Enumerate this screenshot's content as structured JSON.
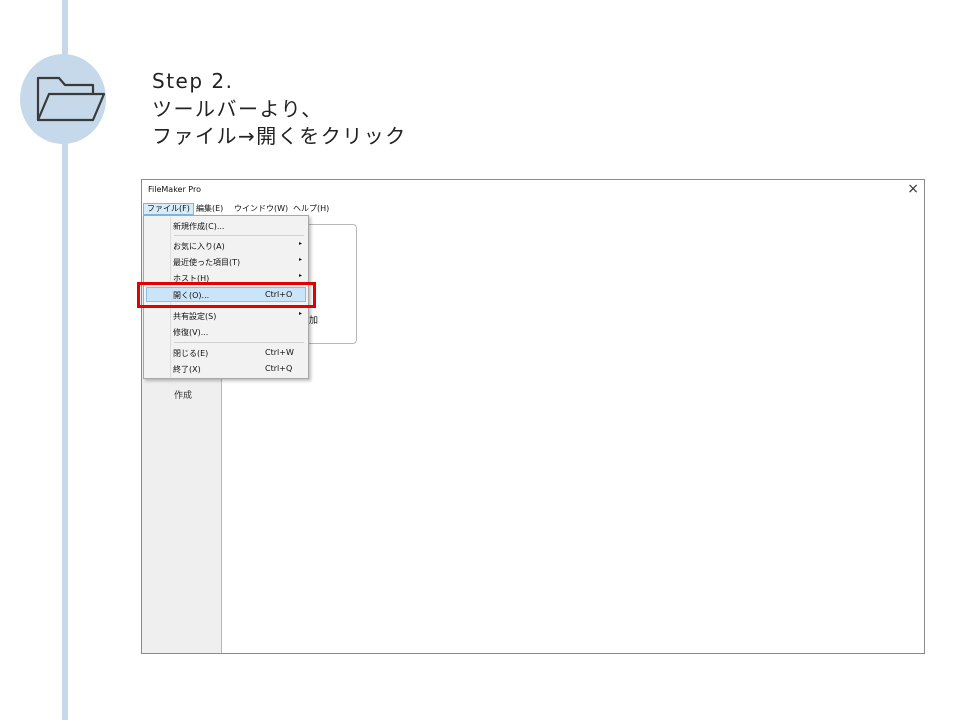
{
  "step": {
    "lines": [
      "Step 2.",
      "ツールバーより、",
      "ファイル→開くをクリック"
    ]
  },
  "icons": {
    "step_icon": "folder-open-icon",
    "close": "close-icon"
  },
  "colors": {
    "timeline": "#c5d9eb",
    "highlight": "#e50000",
    "menu_hover": "#cce4f7"
  },
  "window": {
    "title": "FileMaker Pro",
    "close": "×",
    "menus": [
      "ファイル(F)",
      "編集(E)",
      "ウインドウ(W)",
      "ヘルプ(H)"
    ]
  },
  "file_menu": {
    "items": [
      {
        "label": "新規作成(C)...",
        "shortcut": "",
        "submenu": false
      },
      {
        "label": "お気に入り(A)",
        "shortcut": "",
        "submenu": true
      },
      {
        "label": "最近使った項目(T)",
        "shortcut": "",
        "submenu": true
      },
      {
        "label": "ホスト(H)",
        "shortcut": "",
        "submenu": true
      },
      {
        "label": "開く(O)...",
        "shortcut": "Ctrl+O",
        "submenu": false,
        "highlighted": true
      },
      {
        "label": "共有設定(S)",
        "shortcut": "",
        "submenu": true
      },
      {
        "label": "修復(V)...",
        "shortcut": "",
        "submenu": false
      },
      {
        "label": "閉じる(E)",
        "shortcut": "Ctrl+W",
        "submenu": false
      },
      {
        "label": "終了(X)",
        "shortcut": "Ctrl+Q",
        "submenu": false
      }
    ],
    "arrow": "▸"
  },
  "background": {
    "panel_label": "加",
    "create_label": "作成"
  }
}
